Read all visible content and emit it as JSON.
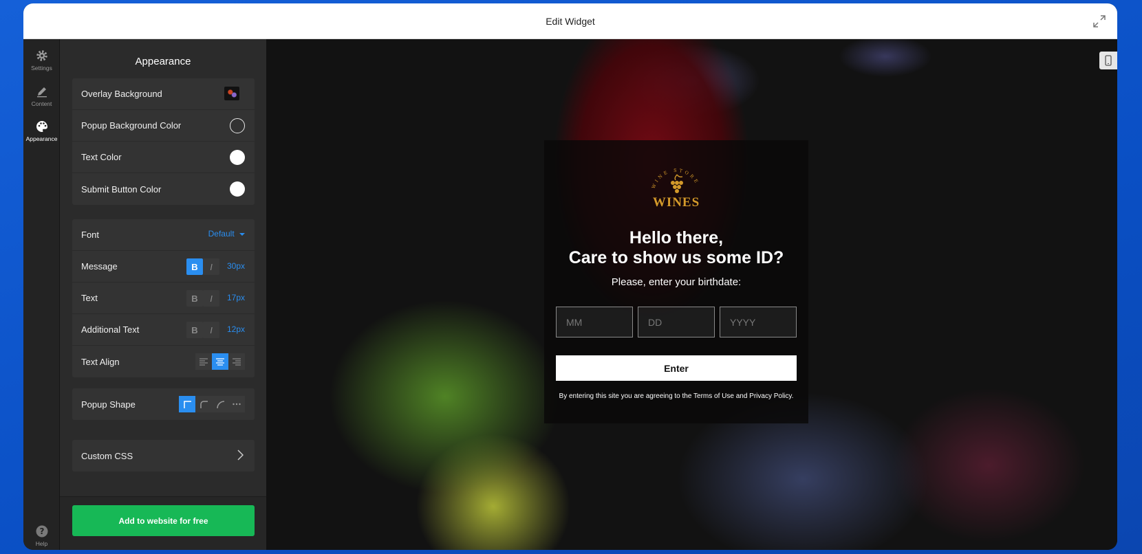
{
  "window": {
    "title": "Edit Widget"
  },
  "rail": {
    "items": [
      {
        "label": "Settings",
        "icon": "gear-icon"
      },
      {
        "label": "Content",
        "icon": "pencil-icon"
      },
      {
        "label": "Appearance",
        "icon": "palette-icon",
        "active": true
      }
    ],
    "help_label": "Help"
  },
  "panel": {
    "title": "Appearance",
    "colors": [
      {
        "label": "Overlay Background",
        "kind": "image"
      },
      {
        "label": "Popup Background Color",
        "kind": "swatch",
        "color": "#1e1e1e"
      },
      {
        "label": "Text Color",
        "kind": "swatch",
        "color": "#ffffff"
      },
      {
        "label": "Submit Button Color",
        "kind": "swatch",
        "color": "#ffffff"
      }
    ],
    "font": {
      "label": "Font",
      "value": "Default"
    },
    "message": {
      "label": "Message",
      "bold": true,
      "italic": false,
      "size": "30px"
    },
    "text": {
      "label": "Text",
      "bold": false,
      "italic": false,
      "size": "17px"
    },
    "additional_text": {
      "label": "Additional Text",
      "bold": false,
      "italic": false,
      "size": "12px"
    },
    "text_align": {
      "label": "Text Align",
      "selected": "center"
    },
    "popup_shape": {
      "label": "Popup Shape",
      "selected": "square"
    },
    "custom_css": {
      "label": "Custom CSS"
    },
    "cta_label": "Add to website for free",
    "bold_glyph": "B",
    "italic_glyph": "I"
  },
  "popup": {
    "logo_text": "WINES",
    "logo_ring_text": "WINE STORE",
    "headline_line1": "Hello there,",
    "headline_line2": "Care to show us some ID?",
    "subtext": "Please, enter your birthdate:",
    "fields": [
      {
        "placeholder": "MM"
      },
      {
        "placeholder": "DD"
      },
      {
        "placeholder": "YYYY"
      }
    ],
    "submit_label": "Enter",
    "legal": "By entering this site you are agreeing to the Terms of Use and Privacy Policy."
  },
  "colors": {
    "accent": "#2a8ef0",
    "cta": "#17b856",
    "logo_gold": "#d49a2a"
  }
}
